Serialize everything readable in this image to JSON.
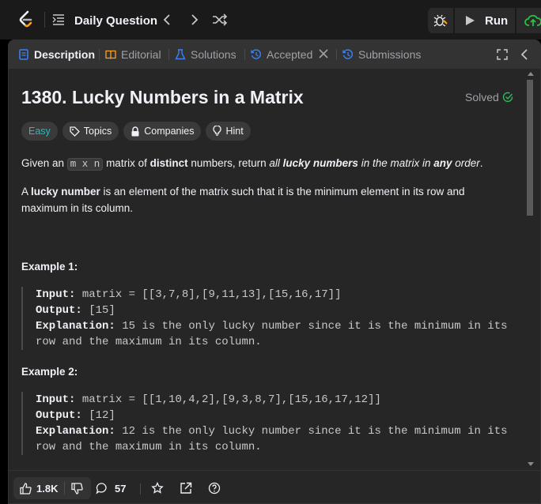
{
  "colors": {
    "accent_orange": "#ffa116",
    "tab_blue": "#3b82f6",
    "easy_teal": "#2cbbba",
    "accepted_green": "#2cbb5d",
    "submit_green": "#28c244"
  },
  "topnav": {
    "title": "Daily Question",
    "run_label": "Run",
    "icons": [
      "leetcode-logo",
      "list-icon",
      "chevron-left-icon",
      "chevron-right-icon",
      "shuffle-icon",
      "debug-icon",
      "play-icon",
      "upload-cloud-icon"
    ]
  },
  "tabs": {
    "description": "Description",
    "editorial": "Editorial",
    "solutions": "Solutions",
    "accepted": "Accepted",
    "submissions": "Submissions"
  },
  "problem": {
    "title": "1380. Lucky Numbers in a Matrix",
    "status": "Solved",
    "tags": {
      "difficulty": "Easy",
      "topics": "Topics",
      "companies": "Companies",
      "hint": "Hint"
    },
    "statement": {
      "p1_pre": "Given an ",
      "p1_code": "m x n",
      "p1_mid": " matrix of ",
      "p1_bold1": "distinct",
      "p1_mid2": " numbers, return ",
      "p1_ital1": "all ",
      "p1_bold_ital": "lucky numbers",
      "p1_ital2": " in the matrix in ",
      "p1_bold_ital2": "any",
      "p1_ital3": " order",
      "p1_end": ".",
      "p2_pre": "A ",
      "p2_bold": "lucky number",
      "p2_rest": " is an element of the matrix such that it is the minimum element in its row and maximum in its column."
    },
    "examples": [
      {
        "heading": "Example 1:",
        "input_label": "Input:",
        "input": " matrix = [[3,7,8],[9,11,13],[15,16,17]]",
        "output_label": "Output:",
        "output": " [15]",
        "explanation_label": "Explanation:",
        "explanation": " 15 is the only lucky number since it is the minimum in its row and the maximum in its column."
      },
      {
        "heading": "Example 2:",
        "input_label": "Input:",
        "input": " matrix = [[1,10,4,2],[9,3,8,7],[15,16,17,12]]",
        "output_label": "Output:",
        "output": " [12]",
        "explanation_label": "Explanation:",
        "explanation": " 12 is the only lucky number since it is the minimum in its row and the maximum in its column."
      }
    ]
  },
  "bottombar": {
    "likes": "1.8K",
    "comments": "57"
  }
}
